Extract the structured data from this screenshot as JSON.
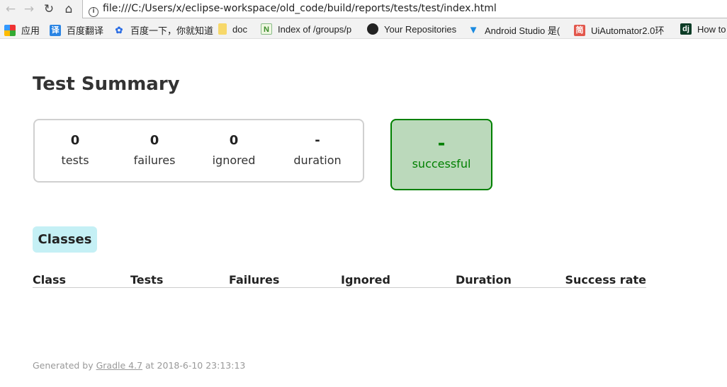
{
  "browser": {
    "url": "file:///C:/Users/x/eclipse-workspace/old_code/build/reports/tests/test/index.html",
    "bookmarks": [
      {
        "label": "应用",
        "icon": "apps-grid-icon"
      },
      {
        "label": "百度翻译",
        "icon": "translate-icon"
      },
      {
        "label": "百度一下，你就知道",
        "icon": "baidu-paw-icon"
      },
      {
        "label": "doc",
        "icon": "folder-icon"
      },
      {
        "label": "Index of /groups/p",
        "icon": "n-icon"
      },
      {
        "label": "Your Repositories",
        "icon": "github-icon"
      },
      {
        "label": "Android Studio 是(",
        "icon": "funnel-icon"
      },
      {
        "label": "UiAutomator2.0环",
        "icon": "jian-icon"
      },
      {
        "label": "How to",
        "icon": "django-icon"
      }
    ]
  },
  "page": {
    "title": "Test Summary",
    "counters": [
      {
        "value": "0",
        "label": "tests"
      },
      {
        "value": "0",
        "label": "failures"
      },
      {
        "value": "0",
        "label": "ignored"
      },
      {
        "value": "-",
        "label": "duration"
      }
    ],
    "success": {
      "value": "-",
      "label": "successful",
      "color": "#008000",
      "bg": "#bbd9bb"
    },
    "tab": "Classes",
    "columns": [
      "Class",
      "Tests",
      "Failures",
      "Ignored",
      "Duration",
      "Success rate"
    ],
    "footer": {
      "prefix": "Generated by ",
      "link": "Gradle 4.7",
      "suffix": " at 2018-6-10 23:13:13"
    }
  }
}
